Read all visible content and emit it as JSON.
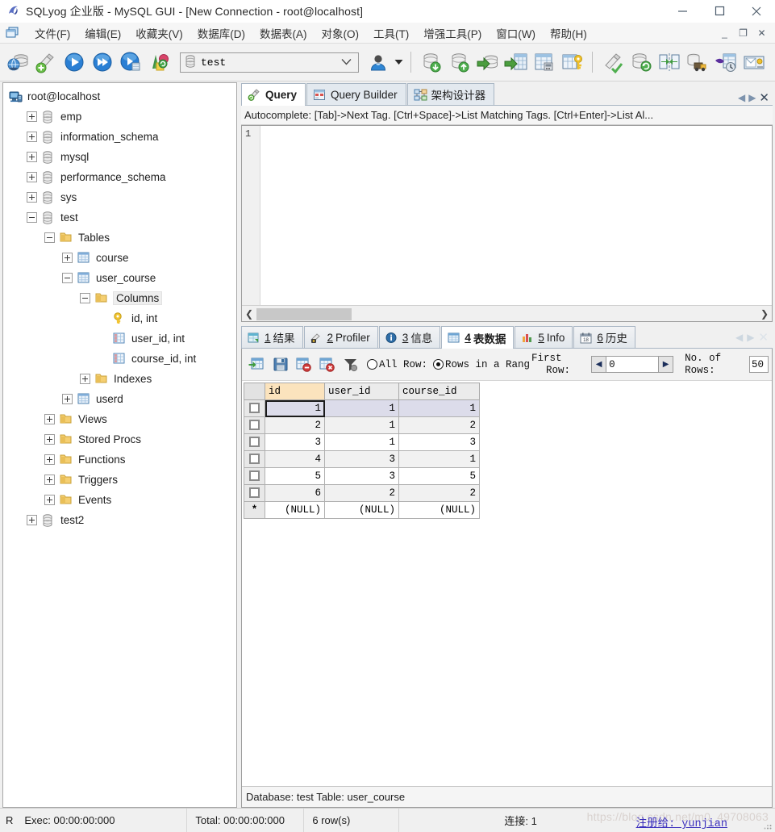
{
  "window": {
    "title": "SQLyog 企业版 - MySQL GUI - [New Connection - root@localhost]",
    "logo_icon": "sqlyog-logo-icon",
    "minimize_label": "—",
    "maximize_label": "□",
    "close_label": "✕"
  },
  "menubar": {
    "mdi_icon": "mdi-window-icon",
    "items": [
      {
        "label": "文件(F)"
      },
      {
        "label": "编辑(E)"
      },
      {
        "label": "收藏夹(V)"
      },
      {
        "label": "数据库(D)"
      },
      {
        "label": "数据表(A)"
      },
      {
        "label": "对象(O)"
      },
      {
        "label": "工具(T)"
      },
      {
        "label": "增强工具(P)"
      },
      {
        "label": "窗口(W)"
      },
      {
        "label": "帮助(H)"
      }
    ],
    "mdi_minimize": "_",
    "mdi_restore": "❐",
    "mdi_close": "✕"
  },
  "toolbar": {
    "buttons": [
      {
        "name": "new-connection-icon",
        "title": "新建连接"
      },
      {
        "name": "new-query-tab-icon",
        "title": "新建查询"
      },
      {
        "name": "execute-query-icon",
        "title": "执行查询"
      },
      {
        "name": "execute-all-queries-icon",
        "title": "执行全部查询"
      },
      {
        "name": "execute-query-current-icon",
        "title": "执行当前查询"
      },
      {
        "name": "stop-query-icon",
        "title": "停止"
      }
    ],
    "database_selector": {
      "icon": "database-icon",
      "value": "test",
      "caret": "⌄"
    },
    "user_icon": "user-manager-icon",
    "user_caret": "▾",
    "buttons2": [
      {
        "name": "backup-database-icon",
        "title": "备份数据库"
      },
      {
        "name": "restore-database-icon",
        "title": "还原数据库"
      },
      {
        "name": "import-external-data-icon",
        "title": "导入外部数据"
      },
      {
        "name": "export-table-data-icon",
        "title": "导出表数据"
      },
      {
        "name": "table-diagnostics-icon",
        "title": "表诊断"
      },
      {
        "name": "manage-index-icon",
        "title": "管理索引"
      }
    ],
    "buttons3": [
      {
        "name": "flush-icon",
        "title": "刷新"
      },
      {
        "name": "sync-database-icon",
        "title": "同步数据库"
      },
      {
        "name": "schema-sync-icon",
        "title": "结构同步"
      },
      {
        "name": "data-transfer-icon",
        "title": "数据传输"
      },
      {
        "name": "scheduled-backup-icon",
        "title": "计划备份"
      },
      {
        "name": "notification-services-icon",
        "title": "通知服务"
      }
    ]
  },
  "tree": {
    "root": {
      "label": "root@localhost",
      "icon": "server-connection-icon"
    },
    "nodes": [
      {
        "label": "emp",
        "icon": "database-icon",
        "indent": 1,
        "state": "collapsed"
      },
      {
        "label": "information_schema",
        "icon": "database-icon",
        "indent": 1,
        "state": "collapsed"
      },
      {
        "label": "mysql",
        "icon": "database-icon",
        "indent": 1,
        "state": "collapsed"
      },
      {
        "label": "performance_schema",
        "icon": "database-icon",
        "indent": 1,
        "state": "collapsed"
      },
      {
        "label": "sys",
        "icon": "database-icon",
        "indent": 1,
        "state": "collapsed"
      },
      {
        "label": "test",
        "icon": "database-icon",
        "indent": 1,
        "state": "expanded"
      },
      {
        "label": "Tables",
        "icon": "folder-icon",
        "indent": 2,
        "state": "expanded"
      },
      {
        "label": "course",
        "icon": "table-icon",
        "indent": 3,
        "state": "collapsed"
      },
      {
        "label": "user_course",
        "icon": "table-icon",
        "indent": 3,
        "state": "expanded"
      },
      {
        "label": "Columns",
        "icon": "folder-icon",
        "indent": 4,
        "state": "expanded",
        "selected": true
      },
      {
        "label": "id, int",
        "icon": "primary-key-icon",
        "indent": 5,
        "state": "leaf"
      },
      {
        "label": "user_id, int",
        "icon": "column-icon",
        "indent": 5,
        "state": "leaf"
      },
      {
        "label": "course_id, int",
        "icon": "column-icon",
        "indent": 5,
        "state": "leaf"
      },
      {
        "label": "Indexes",
        "icon": "folder-icon",
        "indent": 4,
        "state": "collapsed"
      },
      {
        "label": "userd",
        "icon": "table-icon",
        "indent": 3,
        "state": "collapsed"
      },
      {
        "label": "Views",
        "icon": "folder-icon",
        "indent": 2,
        "state": "collapsed"
      },
      {
        "label": "Stored Procs",
        "icon": "folder-icon",
        "indent": 2,
        "state": "collapsed"
      },
      {
        "label": "Functions",
        "icon": "folder-icon",
        "indent": 2,
        "state": "collapsed"
      },
      {
        "label": "Triggers",
        "icon": "folder-icon",
        "indent": 2,
        "state": "collapsed"
      },
      {
        "label": "Events",
        "icon": "folder-icon",
        "indent": 2,
        "state": "collapsed"
      },
      {
        "label": "test2",
        "icon": "database-icon",
        "indent": 1,
        "state": "collapsed"
      }
    ]
  },
  "query_tabs": {
    "tabs": [
      {
        "label": "Query",
        "icon": "query-icon",
        "active": true
      },
      {
        "label": "Query Builder",
        "icon": "query-builder-icon",
        "active": false
      },
      {
        "label": "架构设计器",
        "icon": "schema-designer-icon",
        "active": false
      }
    ],
    "nav_prev": "◀",
    "nav_next": "▶",
    "close": "✕"
  },
  "autocomplete_hint": "Autocomplete: [Tab]->Next Tag. [Ctrl+Space]->List Matching Tags. [Ctrl+Enter]->List Al...",
  "editor": {
    "line_numbers": [
      "1"
    ],
    "content": "",
    "scroll_left_arrow": "❮",
    "scroll_right_arrow": "❯"
  },
  "result_tabs": {
    "tabs": [
      {
        "num": "1",
        "label": "结果",
        "icon": "result-grid-icon",
        "active": false
      },
      {
        "num": "2",
        "label": "Profiler",
        "icon": "profiler-icon",
        "active": false
      },
      {
        "num": "3",
        "label": "信息",
        "icon": "message-info-icon",
        "active": false
      },
      {
        "num": "4",
        "label": "表数据",
        "icon": "table-data-icon",
        "active": true
      },
      {
        "num": "5",
        "label": "Info",
        "icon": "table-info-icon",
        "active": false
      },
      {
        "num": "6",
        "label": "历史",
        "icon": "history-calendar-icon",
        "active": false
      }
    ],
    "nav_prev": "◀",
    "nav_next": "▶",
    "close": "✕"
  },
  "data_toolbar": {
    "buttons": [
      {
        "name": "refresh-data-icon",
        "title": "刷新数据"
      },
      {
        "name": "save-changes-icon",
        "title": "保存修改"
      },
      {
        "name": "delete-row-icon",
        "title": "删除行"
      },
      {
        "name": "discard-changes-icon",
        "title": "放弃修改"
      },
      {
        "name": "filter-icon",
        "title": "筛选"
      }
    ],
    "all_rows_label": "All Row:",
    "all_rows_selected": false,
    "range_rows_label": "Rows in a Rang",
    "range_rows_selected": true,
    "first_row_label_1": "First",
    "first_row_label_2": "Row:",
    "spin_prev": "◀",
    "spin_next": "▶",
    "first_row_value": "0",
    "no_of_rows_label_1": "No.  of",
    "no_of_rows_label_2": "Rows:",
    "no_of_rows_value": "50"
  },
  "grid": {
    "columns": [
      "id",
      "user_id",
      "course_id"
    ],
    "sort_column": "id",
    "new_row_marker": "*",
    "null_text": "(NULL)",
    "rows": [
      {
        "id": "1",
        "user_id": "1",
        "course_id": "1"
      },
      {
        "id": "2",
        "user_id": "1",
        "course_id": "2"
      },
      {
        "id": "3",
        "user_id": "1",
        "course_id": "3"
      },
      {
        "id": "4",
        "user_id": "3",
        "course_id": "1"
      },
      {
        "id": "5",
        "user_id": "3",
        "course_id": "5"
      },
      {
        "id": "6",
        "user_id": "2",
        "course_id": "2"
      }
    ]
  },
  "db_status": "Database: test Table: user_course",
  "statusbar": {
    "mode": "R",
    "exec": "Exec: 00:00:00:000",
    "total": "Total: 00:00:00:000",
    "rows": "6 row(s)",
    "connections": "连接: 1",
    "watermark": "https://blog.csdn.net/m0_49708063",
    "watermark_link": "注册给: yunjian"
  },
  "colors": {
    "accent": "#2e6fb5",
    "tab_border": "#a9b6c4",
    "sort_header": "#fbe3bd",
    "selection": "#dcdcea",
    "link": "#3b2fbd"
  }
}
